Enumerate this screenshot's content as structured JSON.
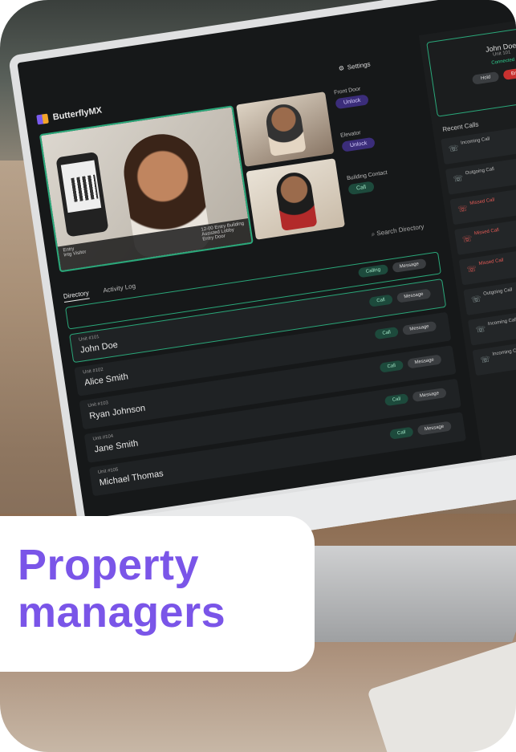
{
  "overlay": {
    "title": "Property\nmanagers"
  },
  "app": {
    "brand": "ButterflyMX",
    "settings_label": "Settings",
    "search_placeholder": "Search Directory",
    "tabs": [
      {
        "label": "Directory",
        "active": true
      },
      {
        "label": "Activity Log",
        "active": false
      }
    ],
    "video_caption": {
      "visitor_label": "Entry",
      "visitor_sub": "Intg Visitor",
      "info_lines": [
        "12-00 Entry Building",
        "Assisted Lobby",
        "Entry Door"
      ]
    },
    "controls": {
      "front_door": {
        "label": "Front Door",
        "button": "Unlock"
      },
      "elevator": {
        "label": "Elevator",
        "button": "Unlock"
      },
      "building_contact": {
        "label": "Building Contact",
        "button": "Call"
      }
    },
    "active_row": {
      "call": "Calling",
      "message": "Message"
    },
    "directory": [
      {
        "unit": "Unit #101",
        "name": "John Doe",
        "call": "Call",
        "message": "Message"
      },
      {
        "unit": "Unit #102",
        "name": "Alice Smith",
        "call": "Call",
        "message": "Message"
      },
      {
        "unit": "Unit #103",
        "name": "Ryan Johnson",
        "call": "Call",
        "message": "Message"
      },
      {
        "unit": "Unit #104",
        "name": "Jane Smith",
        "call": "Call",
        "message": "Message"
      },
      {
        "unit": "Unit #105",
        "name": "Michael Thomas",
        "call": "Call",
        "message": "Message"
      }
    ],
    "current_call": {
      "name": "John Doe",
      "unit": "Unit 101",
      "status": "Connected",
      "hold": "Hold",
      "end": "End Call"
    },
    "recent_calls_title": "Recent Calls",
    "recent_calls": [
      {
        "text": "Incoming Call",
        "missed": false
      },
      {
        "text": "Outgoing Call",
        "missed": false
      },
      {
        "text": "Missed Call",
        "missed": true
      },
      {
        "text": "Missed Call",
        "missed": true
      },
      {
        "text": "Missed Call",
        "missed": true
      },
      {
        "text": "Outgoing Call",
        "missed": false
      },
      {
        "text": "Incoming Call",
        "missed": false
      },
      {
        "text": "Incoming Call",
        "missed": false
      }
    ]
  }
}
